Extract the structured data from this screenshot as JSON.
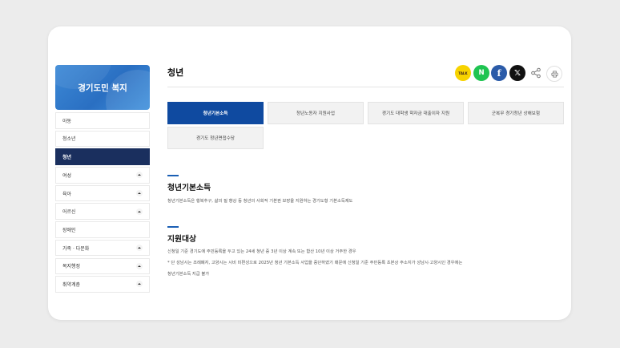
{
  "sidebar": {
    "title": "경기도민 복지",
    "items": [
      {
        "label": "아동",
        "expandable": false,
        "active": false
      },
      {
        "label": "청소년",
        "expandable": false,
        "active": false
      },
      {
        "label": "청년",
        "expandable": false,
        "active": true
      },
      {
        "label": "여성",
        "expandable": true,
        "active": false
      },
      {
        "label": "육아",
        "expandable": true,
        "active": false
      },
      {
        "label": "어르신",
        "expandable": true,
        "active": false
      },
      {
        "label": "장애인",
        "expandable": false,
        "active": false
      },
      {
        "label": "가족 · 다문화",
        "expandable": true,
        "active": false
      },
      {
        "label": "복지행정",
        "expandable": true,
        "active": false
      },
      {
        "label": "취약계층",
        "expandable": true,
        "active": false
      }
    ]
  },
  "page": {
    "title": "청년"
  },
  "share": {
    "kakao": "TALK",
    "naver": "N",
    "facebook": "f",
    "x": "𝕏",
    "share_icon": "share-icon",
    "print_icon": "print-icon",
    "colors": {
      "kakao": "#f7d300",
      "naver": "#1fc451",
      "facebook": "#2b5ba8",
      "x": "#111111"
    }
  },
  "tabs": [
    {
      "label": "청년기본소득",
      "active": true
    },
    {
      "label": "청년노동자 지원사업",
      "active": false
    },
    {
      "label": "경기도 대학생 학자금 대출이자 지원",
      "active": false
    },
    {
      "label": "군복무 경기청년 상해보험",
      "active": false
    },
    {
      "label": "경기도 청년면접수당",
      "active": false
    }
  ],
  "sections": [
    {
      "title": "청년기본소득",
      "lines": [
        "청년기본소득은 행복추구, 삶의 질 향상 등 청년의 사회적 기본권 보장을 지원하는 경기도형 기본소득제도"
      ]
    },
    {
      "title": "지원대상",
      "lines": [
        "신청일 기준 경기도에 주민등록을 두고 있는 24세 청년 중 3년 이상 계속 또는 합산 10년 이상 거주한 경우",
        "* 단 성남시는 조례폐지, 고양시는 시비 미편성으로 2025년 청년 기본소득 사업을 중단하였기 때문에 신청일 기준 주민등록 초본상 주소지가 성남시·고양시인 경우에는",
        "청년기본소득 지급 불가"
      ]
    }
  ],
  "colors": {
    "accent": "#0f4aa0",
    "sidebar_active": "#1a2f5e",
    "header_blue": "#2a6fc2"
  }
}
